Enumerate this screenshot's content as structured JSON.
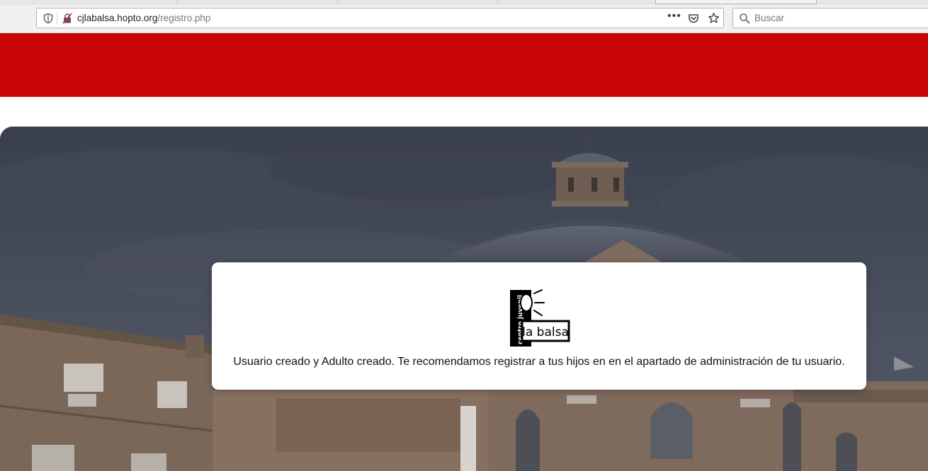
{
  "browser": {
    "url_host": "cjlabalsa.hopto.org",
    "url_path": "/registro.php",
    "more_label": "•••",
    "search_placeholder": "Buscar"
  },
  "icons": {
    "tracking": "shield-icon",
    "insecure": "insecure-lock-icon",
    "pocket": "pocket-icon",
    "bookmark": "star-icon",
    "search": "search-icon"
  },
  "colors": {
    "header": "#c80404",
    "card": "#ffffff"
  },
  "logo": {
    "vertical_text": "centro juvenil",
    "name": "la balsa"
  },
  "message": "Usuario creado y Adulto creado. Te recomendamos registrar a tus hijos en en el apartado de administración de tu usuario."
}
